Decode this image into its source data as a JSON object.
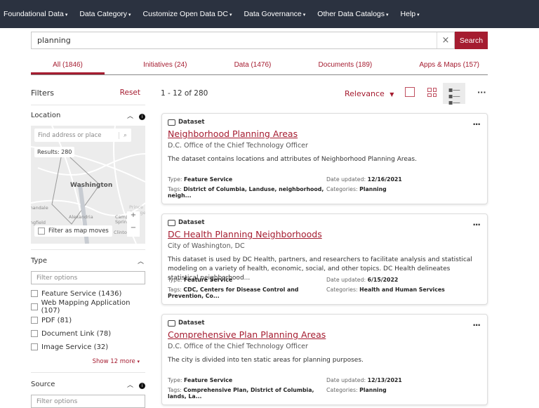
{
  "nav": [
    "Foundational Data",
    "Data Category",
    "Customize Open Data DC",
    "Data Governance",
    "Other Data Catalogs",
    "Help"
  ],
  "search": {
    "value": "planning",
    "clear": "×",
    "button": "Search"
  },
  "tabs": [
    "All (1846)",
    "Initiatives (24)",
    "Data (1476)",
    "Documents (189)",
    "Apps & Maps (157)"
  ],
  "filters": {
    "title": "Filters",
    "reset": "Reset",
    "location": {
      "title": "Location",
      "placeholder": "Find address or place",
      "results": "Results: 280",
      "map_label": "Washington",
      "places": [
        "Alexandria",
        "Annandale",
        "Camp Springs",
        "Clinton",
        "Springfield",
        "Prince George's"
      ],
      "filter_moves": "Filter as map moves",
      "zoom_in": "+",
      "zoom_out": "−"
    },
    "type": {
      "title": "Type",
      "placeholder": "Filter options",
      "options": [
        "Feature Service (1436)",
        "Web Mapping Application (107)",
        "PDF (81)",
        "Document Link (78)",
        "Image Service (32)"
      ],
      "show_more": "Show 12 more"
    },
    "source": {
      "title": "Source",
      "placeholder": "Filter options"
    }
  },
  "results": {
    "count": "1 - 12 of 280",
    "sort": "Relevance",
    "labels": {
      "type": "Type: ",
      "tags": "Tags: ",
      "date": "Date updated: ",
      "cat": "Categories: "
    },
    "items": [
      {
        "kind": "Dataset",
        "title": "Neighborhood Planning Areas",
        "org": "D.C. Office of the Chief Technology Officer",
        "desc": "The dataset contains locations and attributes of Neighborhood Planning Areas.",
        "type": "Feature Service",
        "tags": "District of Columbia, Landuse, neighborhood, neigh...",
        "date": "12/16/2021",
        "cat": "Planning"
      },
      {
        "kind": "Dataset",
        "title": "DC Health Planning Neighborhoods",
        "org": "City of Washington, DC",
        "desc": "This dataset is used by DC Health, partners, and researchers to facilitate analysis and statistical modeling on a variety of health, economic, social, and other topics. DC Health delineates statistical neighborhood...",
        "type": "Feature Service",
        "tags": "CDC, Centers for Disease Control and Prevention, Co...",
        "date": "6/15/2022",
        "cat": "Health and Human Services"
      },
      {
        "kind": "Dataset",
        "title": "Comprehensive Plan Planning Areas",
        "org": "D.C. Office of the Chief Technology Officer",
        "desc": "The city is divided into ten static areas for planning purposes.",
        "type": "Feature Service",
        "tags": "Comprehensive Plan, District of Columbia, lands, La...",
        "date": "12/13/2021",
        "cat": "Planning"
      }
    ]
  },
  "colors": {
    "accent": "#a51c30",
    "nav": "#2b3240"
  }
}
